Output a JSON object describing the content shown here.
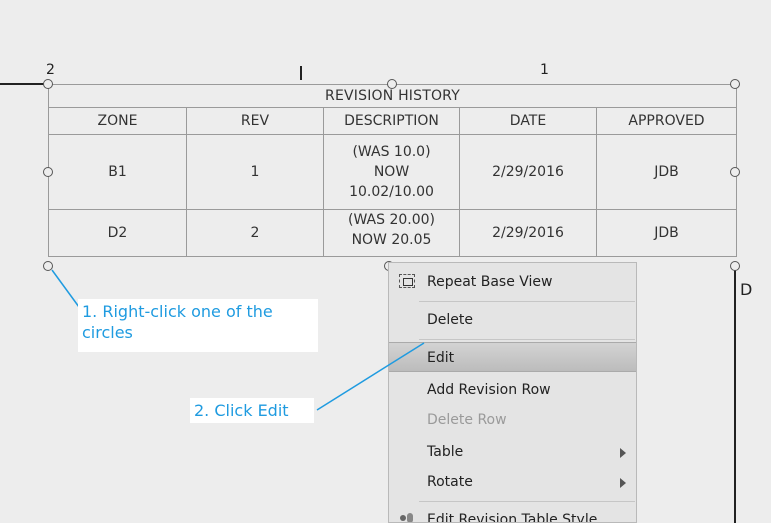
{
  "zone_labels": {
    "left": "2",
    "right": "1",
    "side": "D"
  },
  "revision_table": {
    "title": "REVISION HISTORY",
    "columns": [
      "ZONE",
      "REV",
      "DESCRIPTION",
      "DATE",
      "APPROVED"
    ],
    "rows": [
      {
        "zone": "B1",
        "rev": "1",
        "description": "(WAS 10.0)\nNOW\n10.02/10.00",
        "date": "2/29/2016",
        "approved": "JDB"
      },
      {
        "zone": "D2",
        "rev": "2",
        "description": "(WAS 20.00)\nNOW 20.05",
        "date": "2/29/2016",
        "approved": "JDB"
      }
    ]
  },
  "context_menu": {
    "items": [
      {
        "label": "Repeat Base View",
        "icon": "repeat-base-view-icon",
        "enabled": true
      },
      {
        "label": "Delete",
        "enabled": true
      },
      {
        "label": "Edit",
        "enabled": true,
        "highlighted": true
      },
      {
        "label": "Add Revision Row",
        "enabled": true
      },
      {
        "label": "Delete Row",
        "enabled": false
      },
      {
        "label": "Table",
        "enabled": true,
        "submenu": true
      },
      {
        "label": "Rotate",
        "enabled": true,
        "submenu": true
      },
      {
        "label": "Edit Revision Table Style",
        "icon": "table-style-icon",
        "enabled": true
      }
    ]
  },
  "callouts": {
    "step1": "1. Right-click one of the circles",
    "step2": "2. Click Edit"
  },
  "colors": {
    "callout_text": "#1f9be0",
    "leader_line": "#1f9be0",
    "menu_highlight": "#c4c4c4"
  }
}
